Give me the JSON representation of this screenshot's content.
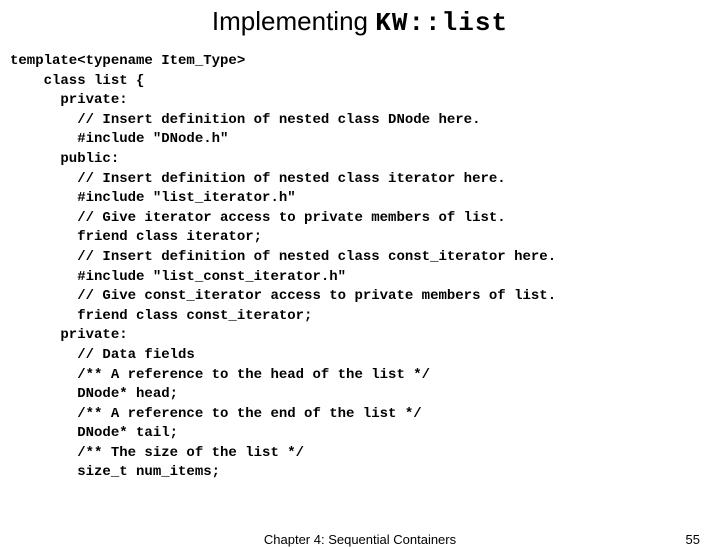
{
  "title_prefix": "Implementing ",
  "title_code": "KW::list",
  "code_lines": [
    "template<typename Item_Type>",
    "    class list {",
    "      private:",
    "        // Insert definition of nested class DNode here.",
    "        #include \"DNode.h\"",
    "      public:",
    "        // Insert definition of nested class iterator here.",
    "        #include \"list_iterator.h\"",
    "        // Give iterator access to private members of list.",
    "        friend class iterator;",
    "        // Insert definition of nested class const_iterator here.",
    "        #include \"list_const_iterator.h\"",
    "        // Give const_iterator access to private members of list.",
    "        friend class const_iterator;",
    "      private:",
    "        // Data fields",
    "        /** A reference to the head of the list */",
    "        DNode* head;",
    "        /** A reference to the end of the list */",
    "        DNode* tail;",
    "        /** The size of the list */",
    "        size_t num_items;"
  ],
  "footer_center": "Chapter 4: Sequential Containers",
  "footer_right": "55"
}
